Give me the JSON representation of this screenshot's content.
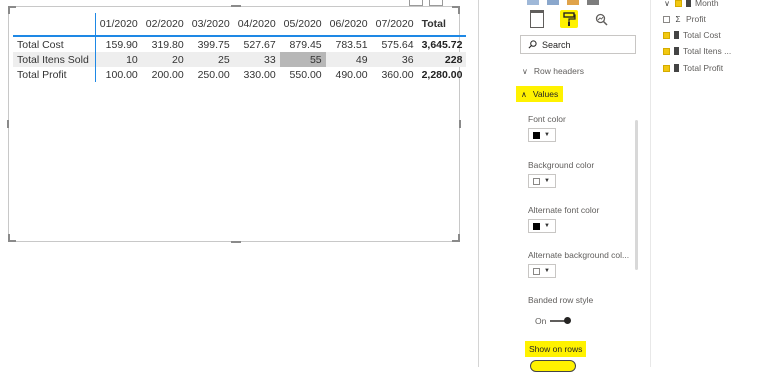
{
  "matrix": {
    "corner_label": "",
    "columns": [
      "01/2020",
      "02/2020",
      "03/2020",
      "04/2020",
      "05/2020",
      "06/2020",
      "07/2020",
      "Total"
    ],
    "rows": [
      {
        "label": "Total Cost",
        "values": [
          "159.90",
          "319.80",
          "399.75",
          "527.67",
          "879.45",
          "783.51",
          "575.64",
          "3,645.72"
        ]
      },
      {
        "label": "Total Itens Sold",
        "values": [
          "10",
          "20",
          "25",
          "33",
          "55",
          "49",
          "36",
          "228"
        ]
      },
      {
        "label": "Total Profit",
        "values": [
          "100.00",
          "200.00",
          "250.00",
          "330.00",
          "550.00",
          "490.00",
          "360.00",
          "2,280.00"
        ]
      }
    ]
  },
  "format_pane": {
    "search_placeholder": "Search",
    "sections": {
      "row_headers": "Row headers",
      "values": "Values"
    },
    "settings": {
      "font_color": "Font color",
      "background_color": "Background color",
      "alternate_font_color": "Alternate font color",
      "alternate_background_color": "Alternate background col...",
      "banded_row_style": "Banded row style",
      "banded_row_value": "On",
      "show_on_rows": "Show on rows"
    },
    "icons": [
      "fields-icon",
      "paint-roller-icon",
      "analytics-icon"
    ]
  },
  "fields_pane": {
    "items": [
      {
        "label": "Month",
        "checked": true
      },
      {
        "label": "Profit",
        "checked": false
      },
      {
        "label": "Total Cost",
        "checked": true
      },
      {
        "label": "Total Itens ...",
        "checked": true
      },
      {
        "label": "Total Profit",
        "checked": true
      }
    ]
  },
  "colors": {
    "highlight": "#fff200",
    "accent_blue": "#1e88e5",
    "checkbox_yellow": "#f2c811",
    "selected_cell": "#b7b7b7"
  }
}
